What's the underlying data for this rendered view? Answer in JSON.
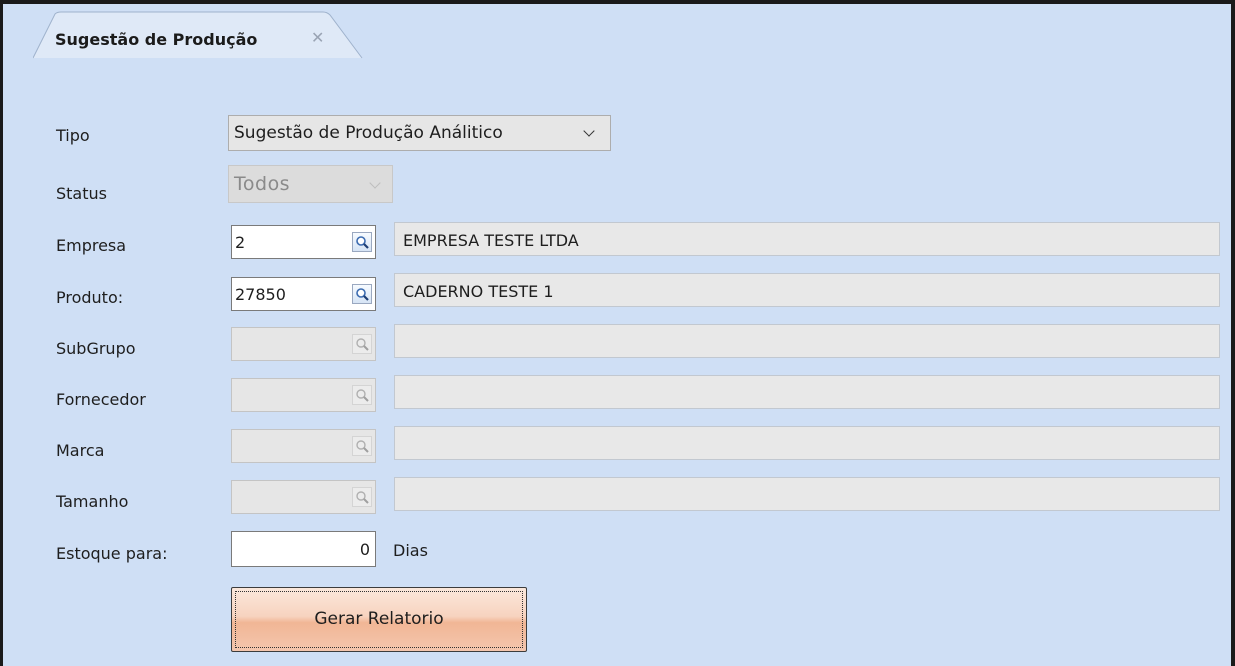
{
  "tab": {
    "title": "Sugestão de Produção",
    "close_glyph": "✕"
  },
  "form": {
    "tipo": {
      "label": "Tipo",
      "value": "Sugestão de Produção Análitico"
    },
    "status": {
      "label": "Status",
      "value": "Todos"
    },
    "empresa": {
      "label": "Empresa",
      "code": "2",
      "description": "EMPRESA TESTE LTDA"
    },
    "produto": {
      "label": "Produto:",
      "code": "27850",
      "description": "CADERNO TESTE 1"
    },
    "subgrupo": {
      "label": "SubGrupo",
      "code": "",
      "description": ""
    },
    "fornecedor": {
      "label": "Fornecedor",
      "code": "",
      "description": ""
    },
    "marca": {
      "label": "Marca",
      "code": "",
      "description": ""
    },
    "tamanho": {
      "label": "Tamanho",
      "code": "",
      "description": ""
    },
    "estoque": {
      "label": "Estoque para:",
      "value": "0",
      "unit": "Dias"
    }
  },
  "actions": {
    "generate_label": "Gerar Relatorio"
  },
  "colors": {
    "panel_bg": "#cfdff5",
    "button_bg": "#f4c6ae"
  },
  "icons": {
    "lookup": "magnifier-icon",
    "dropdown": "chevron-down-icon",
    "close": "close-icon"
  }
}
